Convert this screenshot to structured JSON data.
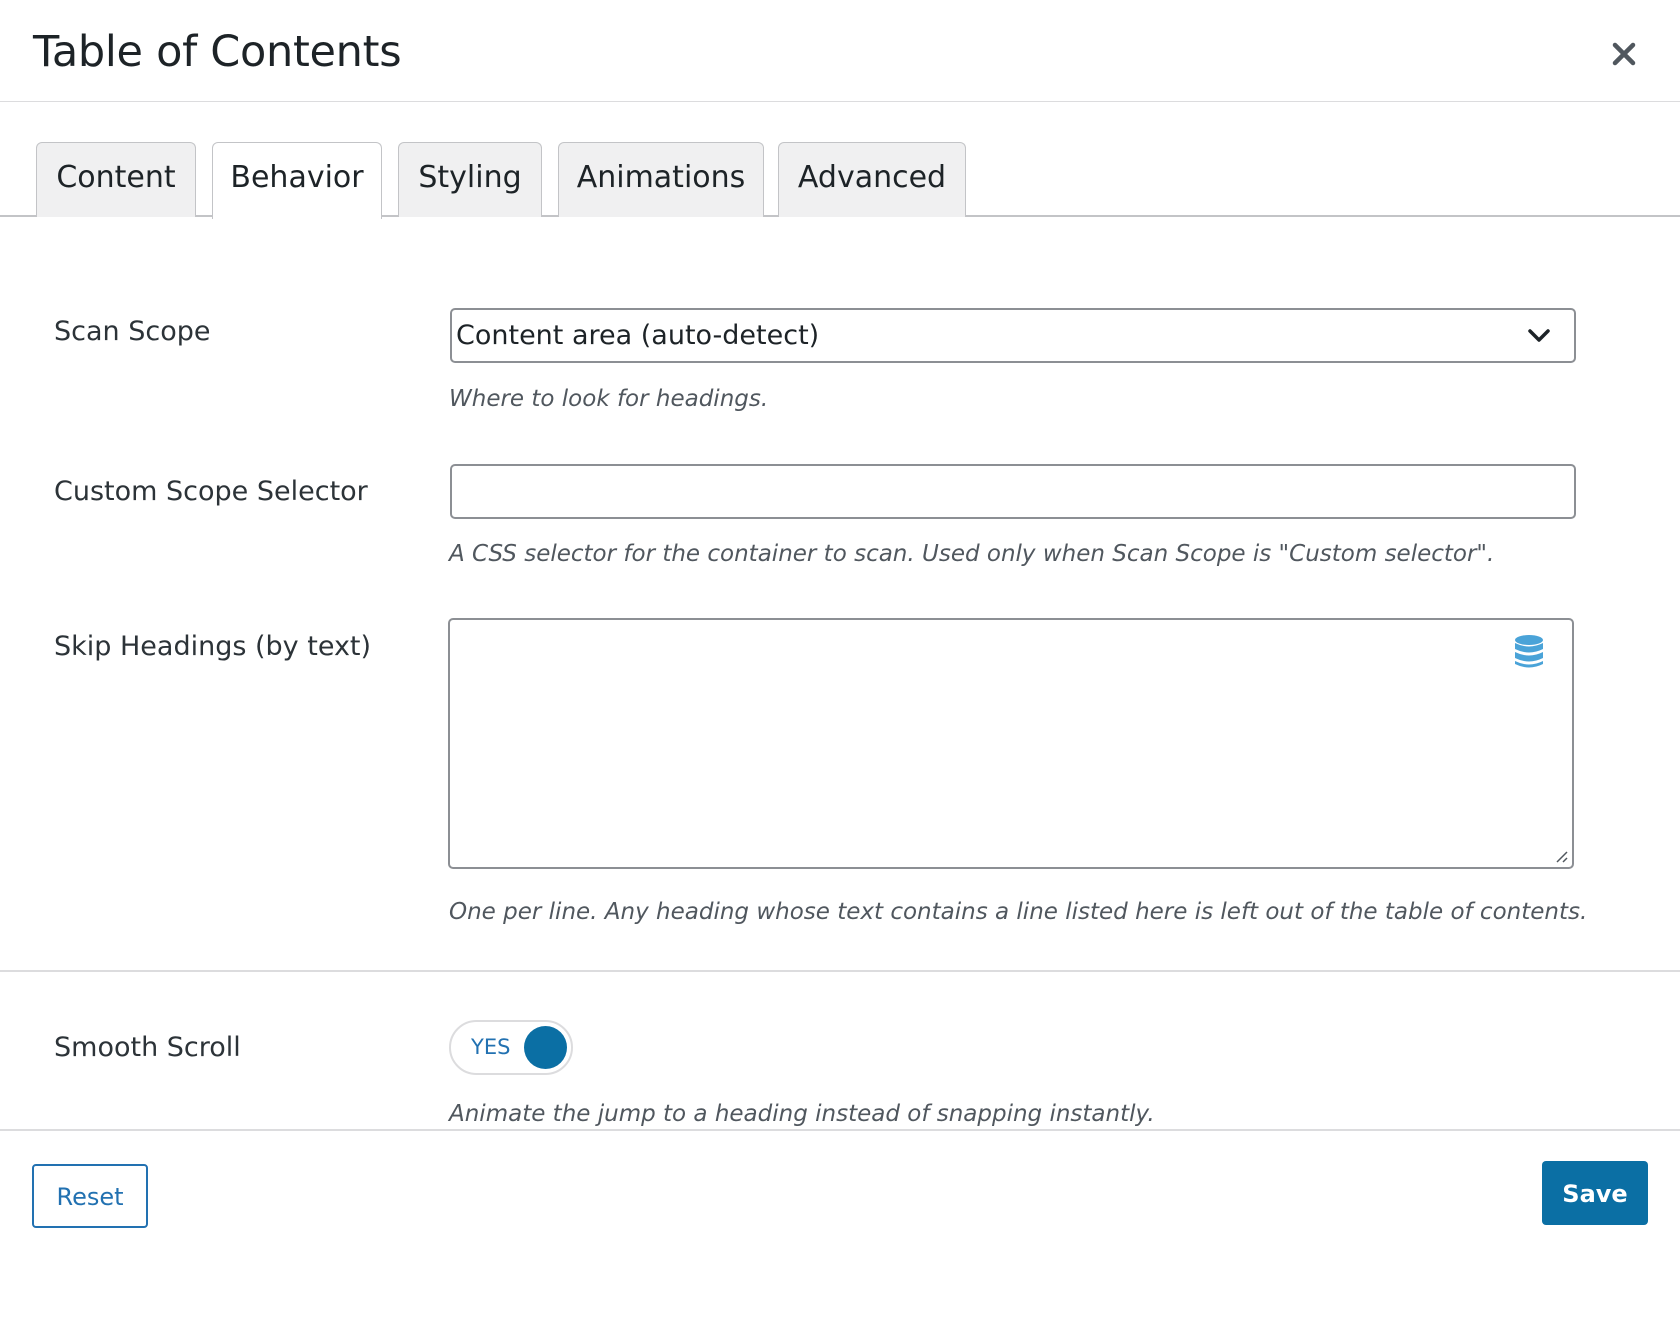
{
  "dialog": {
    "title": "Table of Contents"
  },
  "tabs": [
    {
      "label": "Content",
      "active": false
    },
    {
      "label": "Behavior",
      "active": true
    },
    {
      "label": "Styling",
      "active": false
    },
    {
      "label": "Animations",
      "active": false
    },
    {
      "label": "Advanced",
      "active": false
    }
  ],
  "fields": {
    "scan_scope": {
      "label": "Scan Scope",
      "selected": "Content area (auto-detect)",
      "help": "Where to look for headings."
    },
    "custom_scope_selector": {
      "label": "Custom Scope Selector",
      "value": "",
      "help": "A CSS selector for the container to scan. Used only when Scan Scope is \"Custom selector\"."
    },
    "skip_headings": {
      "label": "Skip Headings (by text)",
      "value": "",
      "help": "One per line. Any heading whose text contains a line listed here is left out of the table of contents."
    },
    "smooth_scroll": {
      "label": "Smooth Scroll",
      "state_label": "YES",
      "on": true,
      "help": "Animate the jump to a heading instead of snapping instantly."
    }
  },
  "footer": {
    "reset_label": "Reset",
    "save_label": "Save"
  },
  "icons": {
    "close": "close-icon",
    "chevron": "chevron-down-icon",
    "dynamic_data": "database-icon"
  },
  "colors": {
    "accent": "#2271b1",
    "primary_button": "#0b6fa4",
    "toggle_knob": "#0b6fa4",
    "database_icon": "#4aa3d8"
  }
}
